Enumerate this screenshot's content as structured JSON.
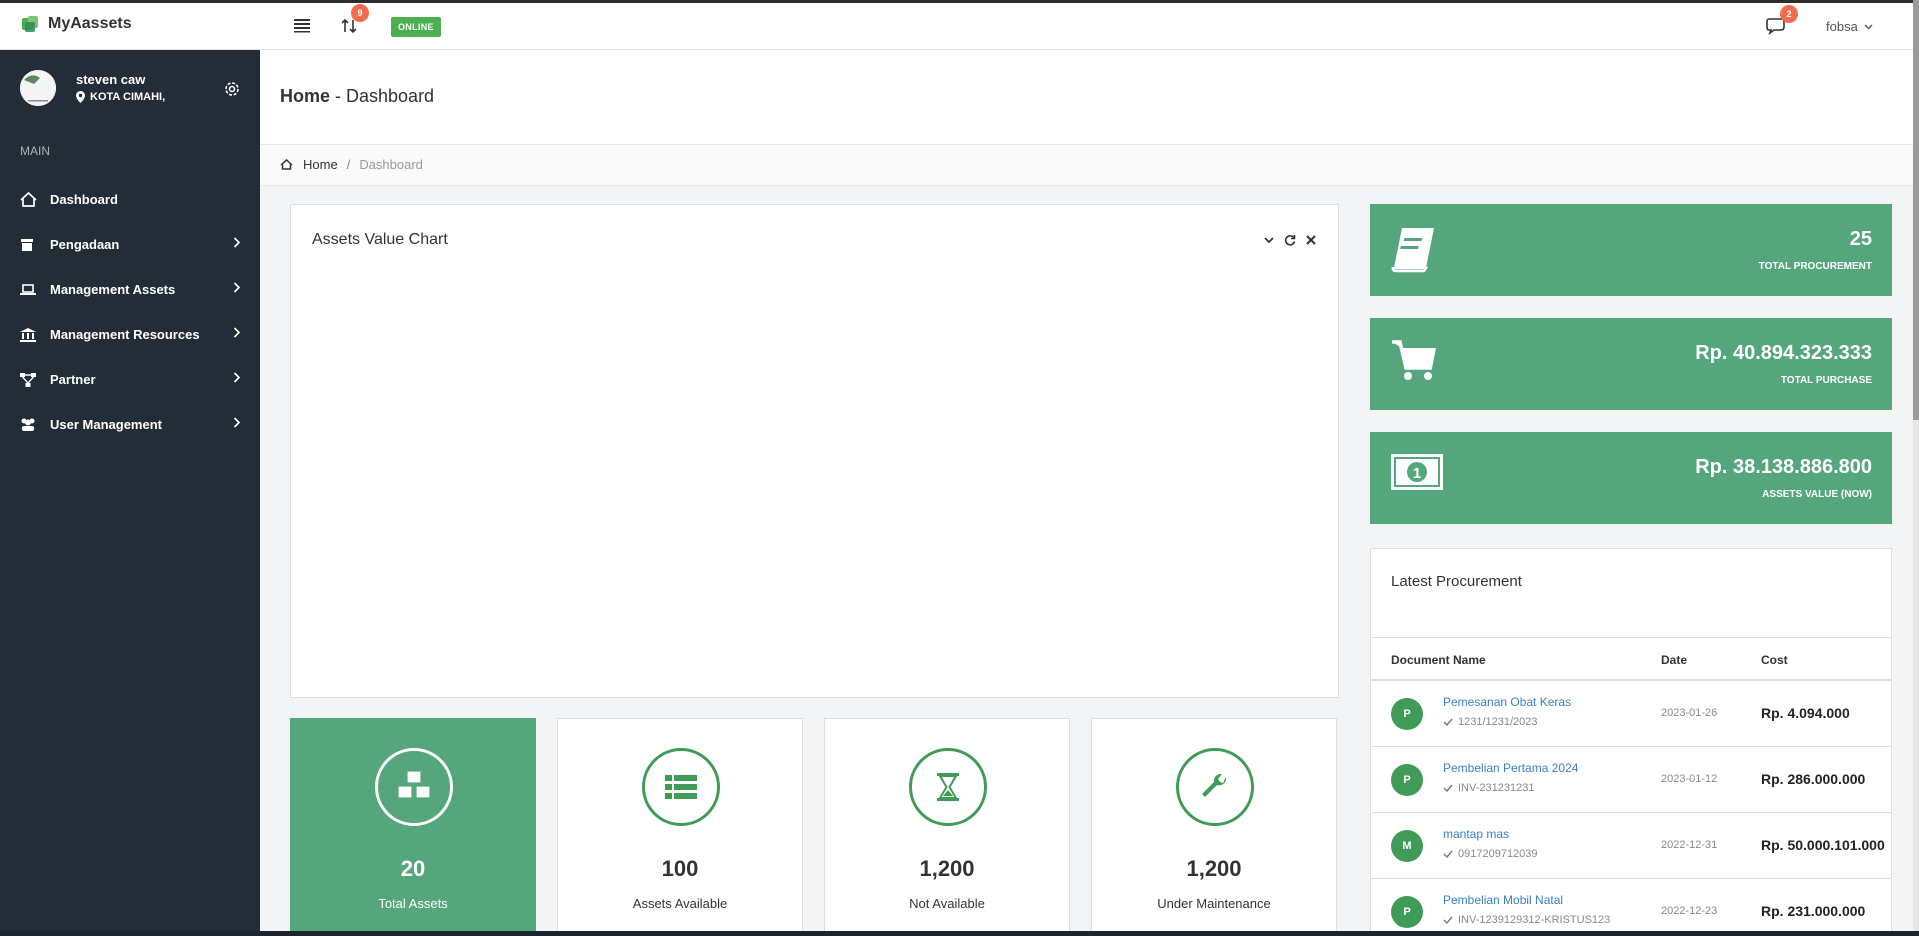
{
  "app": {
    "name": "MyAassets"
  },
  "topbar": {
    "transfer_badge": "9",
    "status": "ONLINE",
    "chat_badge": "2",
    "user": "fobsa"
  },
  "sidebar": {
    "profile": {
      "name": "steven caw",
      "location": "KOTA CIMAHI,"
    },
    "section": "MAIN",
    "items": [
      {
        "label": "Dashboard",
        "icon": "home-icon"
      },
      {
        "label": "Pengadaan",
        "icon": "archive-icon"
      },
      {
        "label": "Management Assets",
        "icon": "laptop-icon"
      },
      {
        "label": "Management Resources",
        "icon": "bank-icon"
      },
      {
        "label": "Partner",
        "icon": "network-icon"
      },
      {
        "label": "User Management",
        "icon": "users-icon"
      }
    ]
  },
  "header": {
    "title_bold": "Home",
    "title_rest": " - Dashboard"
  },
  "breadcrumb": {
    "home": "Home",
    "separator": "/",
    "current": "Dashboard"
  },
  "chart_card": {
    "title": "Assets Value Chart"
  },
  "stats": [
    {
      "value": "20",
      "label": "Total Assets",
      "icon": "cubes-icon"
    },
    {
      "value": "100",
      "label": "Assets Available",
      "icon": "list-icon"
    },
    {
      "value": "1,200",
      "label": "Not Available",
      "icon": "hourglass-icon"
    },
    {
      "value": "1,200",
      "label": "Under Maintenance",
      "icon": "wrench-icon"
    }
  ],
  "summary": [
    {
      "value": "25",
      "label": "TOTAL PROCUREMENT",
      "icon": "book-icon"
    },
    {
      "value": "Rp. 40.894.323.333",
      "label": "TOTAL PURCHASE",
      "icon": "cart-icon"
    },
    {
      "value": "Rp. 38.138.886.800",
      "label": "ASSETS VALUE (NOW)",
      "icon": "money-icon"
    }
  ],
  "procurement": {
    "title": "Latest Procurement",
    "columns": [
      "Document Name",
      "Date",
      "Cost"
    ],
    "rows": [
      {
        "initial": "P",
        "name": "Pemesanan Obat Keras",
        "doc": "1231/1231/2023",
        "date": "2023-01-26",
        "cost": "Rp. 4.094.000"
      },
      {
        "initial": "P",
        "name": "Pembelian Pertama 2024",
        "doc": "INV-231231231",
        "date": "2023-01-12",
        "cost": "Rp. 286.000.000"
      },
      {
        "initial": "M",
        "name": "mantap mas",
        "doc": "0917209712039",
        "date": "2022-12-31",
        "cost": "Rp. 50.000.101.000"
      },
      {
        "initial": "P",
        "name": "Pembelian Mobil Natal",
        "doc": "INV-1239129312-KRISTUS123",
        "date": "2022-12-23",
        "cost": "Rp. 231.000.000"
      }
    ]
  },
  "colors": {
    "accent": "#55a67d",
    "accent_dark": "#3f9b57",
    "sidebar": "#232d37",
    "badge": "#f26c4f",
    "link": "#3b7fc4"
  }
}
